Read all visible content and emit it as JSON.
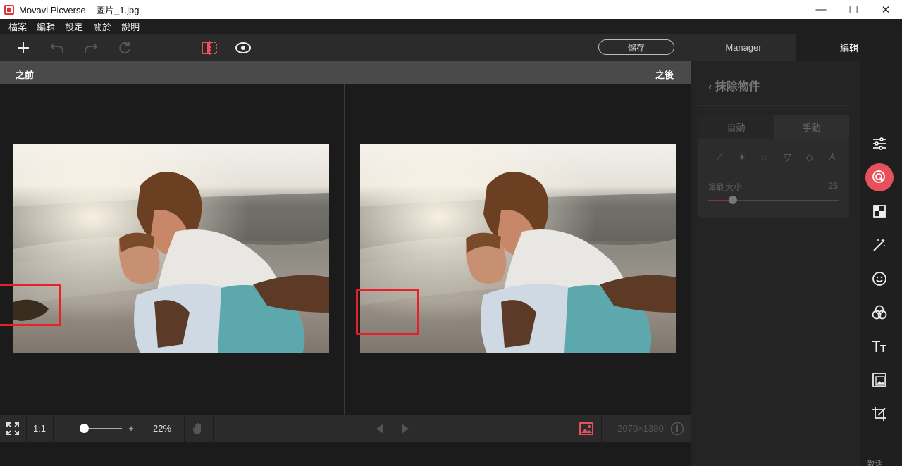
{
  "window": {
    "title": "Movavi Picverse – 圖片_1.jpg",
    "minimize": "—",
    "maximize": "☐",
    "close": "✕"
  },
  "menu": [
    "檔案",
    "編輯",
    "設定",
    "關於",
    "說明"
  ],
  "toolbar": {
    "add_icon": "plus-icon",
    "undo_icon": "undo-icon",
    "redo_icon": "redo-icon",
    "reset_icon": "reset-icon",
    "compare_icon": "split-view-icon",
    "preview_icon": "eye-icon",
    "save_label": "儲存",
    "tab_manager": "Manager",
    "tab_edit": "編輯"
  },
  "compare": {
    "before_label": "之前",
    "after_label": "之後"
  },
  "bottombar": {
    "fit_icon": "fit-screen-icon",
    "one_to_one": "1:1",
    "zoom_minus": "–",
    "zoom_plus": "+",
    "zoom_value": "22%",
    "zoom_level": 0.1,
    "hand_icon": "hand-icon",
    "prev_icon": "prev-icon",
    "next_icon": "next-icon",
    "image_icon": "image-icon",
    "dimensions": "2070×1380",
    "info_icon": "info-icon"
  },
  "right_panel": {
    "back_title": "抹除物件",
    "tab_auto": "自動",
    "tab_manual": "手動",
    "tools": [
      "brush-icon",
      "magic-wand-icon",
      "lasso-icon",
      "polygon-lasso-icon",
      "eraser-icon",
      "stamp-icon"
    ],
    "brush_size_label": "筆刷大小",
    "brush_size_value": "25"
  },
  "icon_strip": [
    {
      "name": "adjustments-icon"
    },
    {
      "name": "object-eraser-icon",
      "active": true
    },
    {
      "name": "background-icon"
    },
    {
      "name": "retouch-icon"
    },
    {
      "name": "face-icon"
    },
    {
      "name": "filters-icon"
    },
    {
      "name": "text-icon"
    },
    {
      "name": "watermark-icon"
    },
    {
      "name": "crop-icon"
    }
  ],
  "icon_strip_footer": "激活",
  "colors": {
    "accent": "#e8505b",
    "highlight_box": "#e8202a"
  }
}
